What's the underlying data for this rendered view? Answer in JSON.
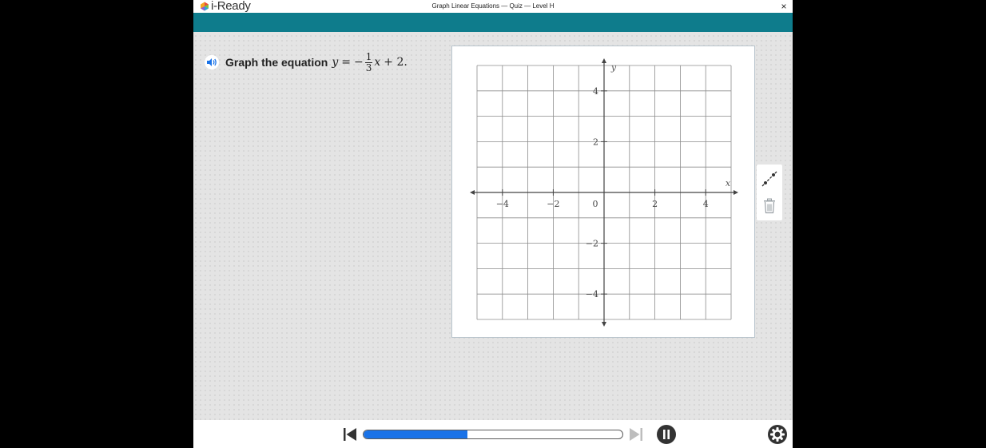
{
  "app": {
    "logo_text": "i-Ready",
    "title": "Graph Linear Equations — Quiz — Level H",
    "close_symbol": "×"
  },
  "question": {
    "prompt": "Graph the equation",
    "equation": {
      "lhs": "y",
      "equals": "=",
      "sign": "−",
      "numerator": "1",
      "denominator": "3",
      "x": "x",
      "tail": "+ 2."
    }
  },
  "graph": {
    "x_axis_label": "x",
    "y_axis_label": "y",
    "range": [
      -5,
      5
    ],
    "grid_step": 1,
    "x_ticks": [
      {
        "v": -4,
        "t": "−4"
      },
      {
        "v": -2,
        "t": "−2"
      },
      {
        "v": 0,
        "t": "0"
      },
      {
        "v": 2,
        "t": "2"
      },
      {
        "v": 4,
        "t": "4"
      }
    ],
    "y_ticks": [
      {
        "v": 4,
        "t": "4"
      },
      {
        "v": 2,
        "t": "2"
      },
      {
        "v": -2,
        "t": "−2"
      },
      {
        "v": -4,
        "t": "−4"
      }
    ]
  },
  "tools": {
    "items": [
      "line-tool-icon",
      "trash-icon"
    ]
  },
  "controls": {
    "progress": 0.4
  },
  "colors": {
    "header": "#0e7c8c",
    "progress": "#1a73e8",
    "page_bg": "#e4e4e4"
  }
}
